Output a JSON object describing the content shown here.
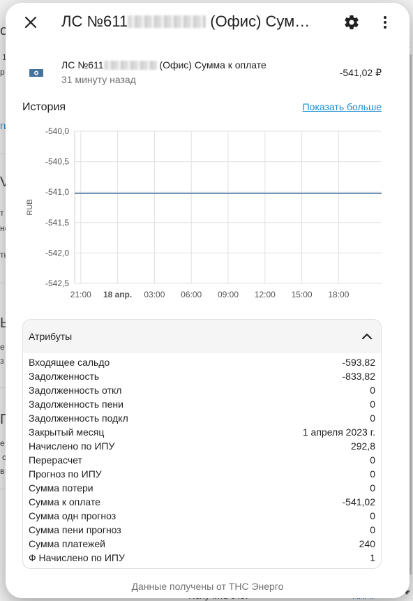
{
  "dialog": {
    "title_prefix": "ЛС №611",
    "title_suffix": " (Офис) Сумм…",
    "entity": {
      "name_prefix": "ЛС №611",
      "name_suffix": " (Офис) Сумма к оплате",
      "last_changed": "31 минуту назад",
      "value": "-541,02 ₽",
      "icon": "cash-icon"
    },
    "history": {
      "title": "История",
      "show_more": "Показать больше"
    },
    "attributes": {
      "title": "Атрибуты",
      "rows": [
        {
          "label": "Входящее сальдо",
          "value": "-593,82"
        },
        {
          "label": "Задолженность",
          "value": "-833,82"
        },
        {
          "label": "Задолженность откл",
          "value": "0"
        },
        {
          "label": "Задолженность пени",
          "value": "0"
        },
        {
          "label": "Задолженность подкл",
          "value": "0"
        },
        {
          "label": "Закрытый месяц",
          "value": "1 апреля 2023 г."
        },
        {
          "label": "Начислено по ИПУ",
          "value": "292,8"
        },
        {
          "label": "Перерасчет",
          "value": "0"
        },
        {
          "label": "Прогноз по ИПУ",
          "value": "0"
        },
        {
          "label": "Сумма потери",
          "value": "0"
        },
        {
          "label": "Сумма к оплате",
          "value": "-541,02"
        },
        {
          "label": "Сумма одн прогноз",
          "value": "0"
        },
        {
          "label": "Сумма пени прогноз",
          "value": "0"
        },
        {
          "label": "Сумма платежей",
          "value": "240"
        },
        {
          "label": "Ф Начислено по ИПУ",
          "value": "1"
        }
      ]
    },
    "footer": "Данные получены от ТНС Энерго"
  },
  "background": {
    "fragments": [
      "о",
      "1",
      "р",
      "ги",
      "V",
      "т",
      "не",
      "ть",
      "Ь",
      "е",
      "з",
      "П",
      "е",
      "с",
      "в"
    ],
    "bottom_text": "Получить счет",
    "bottom_link": "ПЛАТ"
  },
  "chart_data": {
    "type": "line",
    "title": "",
    "xlabel": "",
    "ylabel": "RUB",
    "ylim": [
      -542.5,
      -540.0
    ],
    "yticks": [
      "-540,0",
      "-540,5",
      "-541,0",
      "-541,5",
      "-542,0",
      "-542,5"
    ],
    "ytick_values": [
      -540.0,
      -540.5,
      -541.0,
      -541.5,
      -542.0,
      -542.5
    ],
    "xticks": [
      "21:00",
      "18 апр.",
      "03:00",
      "06:00",
      "09:00",
      "12:00",
      "15:00",
      "18:00"
    ],
    "xtick_hours": [
      0,
      3,
      6,
      9,
      12,
      15,
      18,
      21
    ],
    "xlim_hours": [
      -0.5,
      24.5
    ],
    "series": [
      {
        "x_hours": [
          -0.5,
          24.5
        ],
        "values": [
          -541.02,
          -541.02
        ]
      }
    ],
    "grid": true,
    "colors": {
      "line": "#44739e",
      "grid": "#e0e0e0"
    }
  }
}
